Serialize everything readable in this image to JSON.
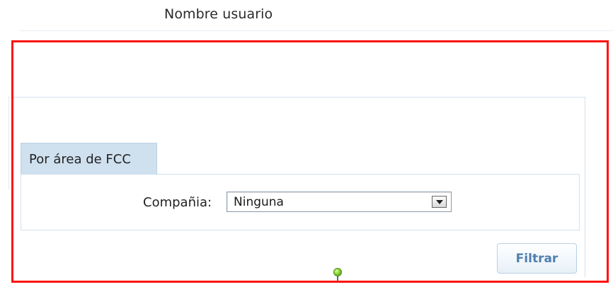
{
  "header": {
    "user_name_label": "Nombre usuario"
  },
  "tabs": [
    {
      "label": "Por área de FCC"
    }
  ],
  "filters": {
    "company_label": "Compañia:",
    "company_value": "Ninguna",
    "button_label": "Filtrar"
  },
  "colors": {
    "highlight": "#ff1010",
    "tab_background": "#cfe0ef",
    "button_text": "#4f7fae",
    "handle": "#71c11f"
  },
  "icons": {
    "select_arrow": "chevron-down-icon",
    "handle": "green-handle-icon"
  }
}
